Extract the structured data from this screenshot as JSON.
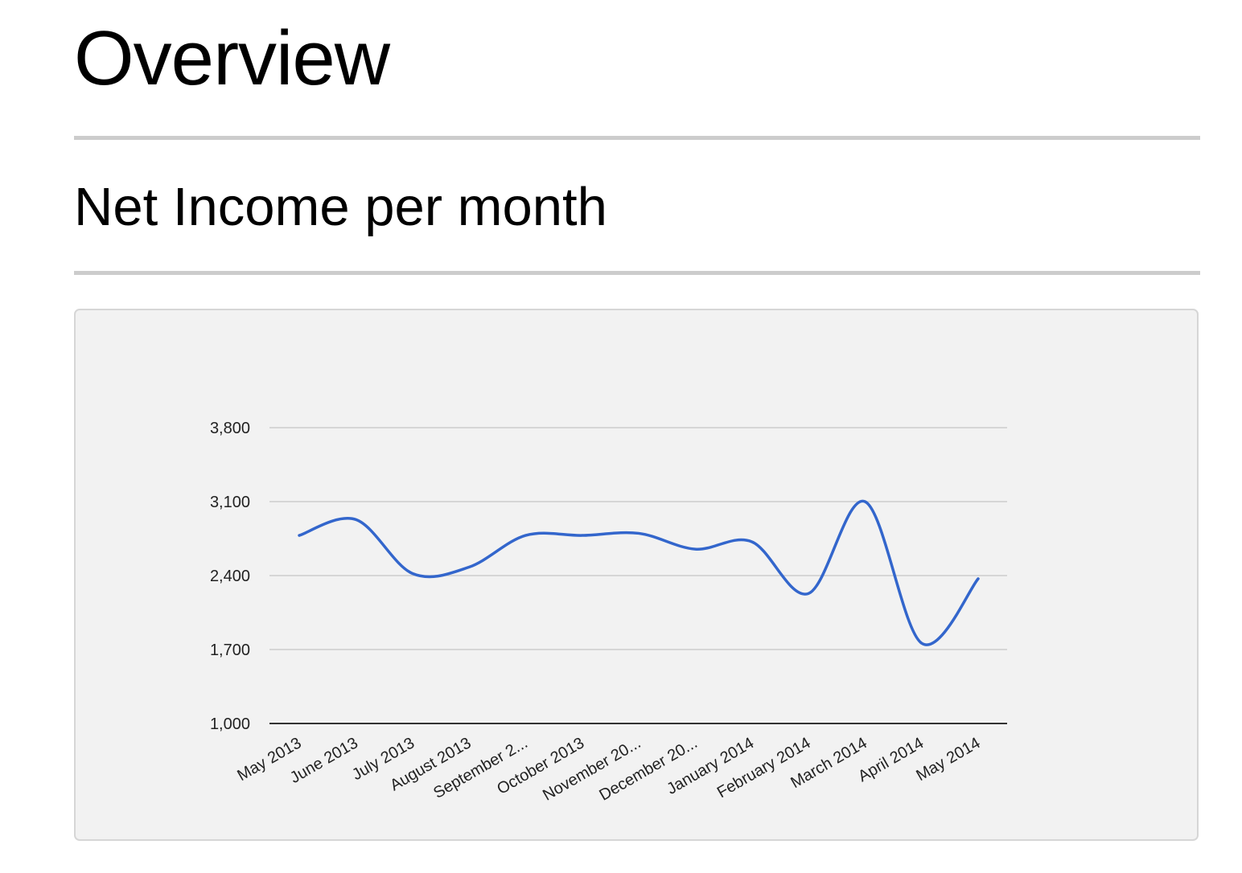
{
  "page": {
    "title": "Overview",
    "section_title": "Net Income per month"
  },
  "chart_data": {
    "type": "line",
    "title": "",
    "xlabel": "",
    "ylabel": "",
    "categories": [
      "May 2013",
      "June 2013",
      "July 2013",
      "August 2013",
      "September 2...",
      "October 2013",
      "November 20...",
      "December 20...",
      "January 2014",
      "February 2014",
      "March 2014",
      "April 2014",
      "May 2014"
    ],
    "series": [
      {
        "values": [
          2780,
          2930,
          2420,
          2480,
          2780,
          2780,
          2800,
          2650,
          2720,
          2230,
          3100,
          1760,
          2370
        ]
      }
    ],
    "ylim": [
      1000,
      3800
    ],
    "yticks": [
      1000,
      1700,
      2400,
      3100,
      3800
    ],
    "ytick_labels": [
      "1,000",
      "1,700",
      "2,400",
      "3,100",
      "3,800"
    ],
    "grid": true,
    "legend": "none",
    "line_color": "#3366cc",
    "grid_color": "#cccccc",
    "axis_color": "#333333"
  }
}
